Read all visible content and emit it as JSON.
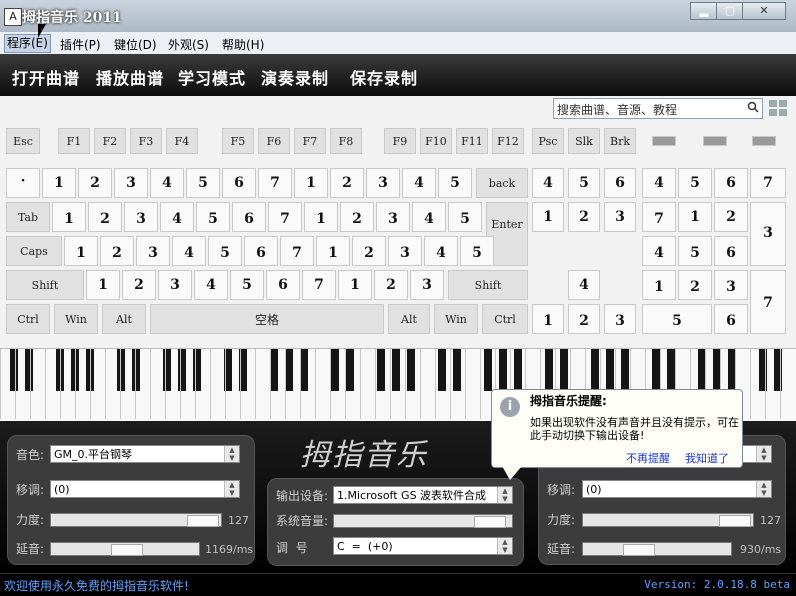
{
  "window": {
    "title": "拇指音乐 2011",
    "icon_text": "A",
    "minimize": "▂",
    "maximize": "▢",
    "close": "✕"
  },
  "menu": {
    "items": [
      "程序(E)",
      "插件(P)",
      "键位(D)",
      "外观(S)",
      "帮助(H)"
    ]
  },
  "toolbar": {
    "items": [
      "打开曲谱",
      "播放曲谱",
      "学习模式",
      "演奏录制",
      "保存录制"
    ]
  },
  "search": {
    "placeholder": "搜索曲谱、音源、教程"
  },
  "keyboard": {
    "fn_row": [
      "Esc",
      "F1",
      "F2",
      "F3",
      "F4",
      "F5",
      "F6",
      "F7",
      "F8",
      "F9",
      "F10",
      "F11",
      "F12",
      "Psc",
      "Slk",
      "Brk"
    ],
    "back": "back",
    "tab": "Tab",
    "enter": "Enter",
    "caps": "Caps",
    "shift": "Shift",
    "ctrl": "Ctrl",
    "win": "Win",
    "alt": "Alt",
    "space": "空格"
  },
  "notes": {
    "row1": [
      "·",
      "1",
      "2",
      "3",
      "4",
      "5",
      "6",
      "7",
      "1",
      "2",
      "3",
      "4",
      "5"
    ],
    "row2": [
      "1",
      "2",
      "3",
      "4",
      "5",
      "6",
      "7",
      "1",
      "2",
      "3",
      "4",
      "5"
    ],
    "row3": [
      "1",
      "2",
      "3",
      "4",
      "5",
      "6",
      "7",
      "1",
      "2",
      "3",
      "4",
      "5"
    ],
    "row4": [
      "1",
      "2",
      "3",
      "4",
      "5",
      "6",
      "7",
      "1",
      "2",
      "3"
    ],
    "nav_top": [
      "4",
      "5",
      "6"
    ],
    "nav_mid": [
      "1",
      "2",
      "3"
    ],
    "nav_down": "4",
    "nav_bottom": [
      "1",
      "2",
      "3"
    ],
    "numpad": [
      "4",
      "5",
      "6",
      "7",
      "7",
      "1",
      "2",
      "3",
      "4",
      "5",
      "6",
      "1",
      "2",
      "3",
      "7",
      "5",
      "6"
    ]
  },
  "panel_left": {
    "timbre_label": "音色:",
    "timbre_value": "GM_0.平台钢琴",
    "transpose_label": "移调:",
    "transpose_value": "(0)",
    "force_label": "力度:",
    "force_value": "127",
    "sustain_label": "延音:",
    "sustain_value": "1169/ms"
  },
  "panel_center": {
    "output_label": "输出设备:",
    "output_value": "1.Microsoft GS 波表软件合成",
    "volume_label": "系统音量:",
    "key_label": "调  号",
    "key_value": "C  =  (+0)"
  },
  "panel_right": {
    "transpose_label": "移调:",
    "transpose_value": "(0)",
    "force_label": "力度:",
    "force_value": "127",
    "sustain_label": "延音:",
    "sustain_value": "930/ms"
  },
  "logo": {
    "text": "拇指音乐"
  },
  "notification": {
    "title": "拇指音乐提醒:",
    "body": "如果出现软件没有声音并且没有提示，可在此手动切换下输出设备!",
    "link_dismiss": "不再提醒",
    "link_ok": "我知道了"
  },
  "status": {
    "left": "欢迎使用永久免费的拇指音乐软件!",
    "version": "Version: 2.0.18.8 beta"
  },
  "colors": {
    "toolbar_bg": "#1a1a1a",
    "status_text": "#5aa4ff",
    "link": "#1a36d8"
  }
}
